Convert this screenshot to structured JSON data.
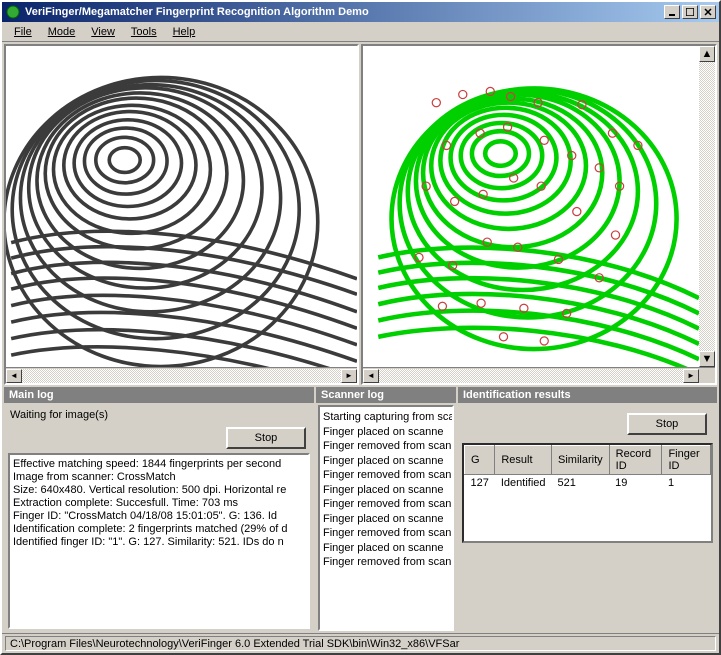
{
  "window": {
    "title": "VeriFinger/Megamatcher Fingerprint Recognition Algorithm Demo"
  },
  "menu": {
    "file": "File",
    "mode": "Mode",
    "view": "View",
    "tools": "Tools",
    "help": "Help"
  },
  "mainlog": {
    "title": "Main log",
    "waiting": "Waiting for image(s)",
    "stop": "Stop",
    "lines": [
      "Effective matching speed: 1844 fingerprints per second",
      "",
      "Image from scanner: CrossMatch",
      "Size: 640x480. Vertical resolution: 500 dpi. Horizontal re",
      "Extraction complete: Succesfull. Time: 703 ms",
      "Finger ID: \"CrossMatch 04/18/08 15:01:05\". G: 136. Id",
      "Identification complete: 2 fingerprints matched (29% of d",
      "Identified finger ID: \"1\". G: 127. Similarity: 521. IDs do n"
    ]
  },
  "scannerlog": {
    "title": "Scanner log",
    "lines": [
      "Starting capturing from sca",
      "Finger placed on scanne",
      "Finger removed from scan",
      "Finger placed on scanne",
      "Finger removed from scan",
      "Finger placed on scanne",
      "Finger removed from scan",
      "Finger placed on scanne",
      "Finger removed from scan",
      "Finger placed on scanne",
      "Finger removed from scan"
    ]
  },
  "results": {
    "title": "Identification results",
    "stop": "Stop",
    "headers": {
      "g": "G",
      "result": "Result",
      "similarity": "Similarity",
      "record": "Record ID",
      "finger": "Finger ID"
    },
    "row": {
      "g": "127",
      "result": "Identified",
      "similarity": "521",
      "record": "19",
      "finger": "1"
    }
  },
  "statusbar": "C:\\Program Files\\Neurotechnology\\VeriFinger 6.0 Extended Trial SDK\\bin\\Win32_x86\\VFSar"
}
